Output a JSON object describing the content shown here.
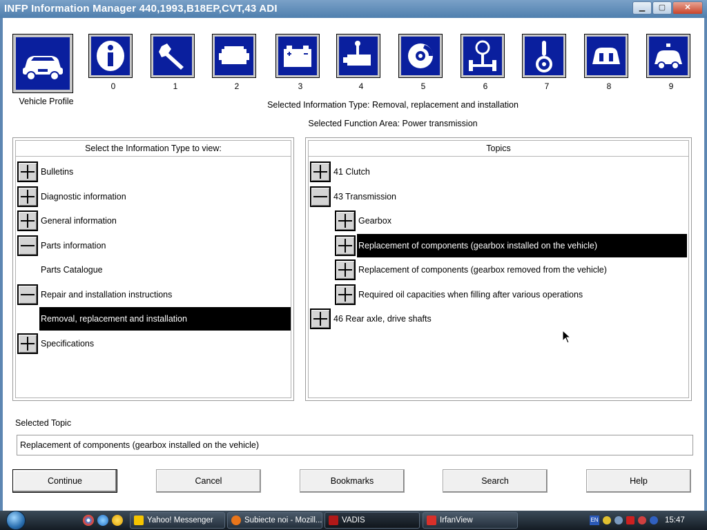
{
  "window": {
    "title": "INFP Information Manager 440,1993,B18EP,CVT,43 ADI",
    "minimize_glyph": "▁",
    "maximize_glyph": "▢",
    "close_glyph": "✕"
  },
  "icons": [
    {
      "id": "vehicle-profile",
      "icon": "car-icon",
      "label": "Vehicle Profile"
    },
    {
      "id": "info",
      "icon": "info-icon",
      "label": "0"
    },
    {
      "id": "tools",
      "icon": "wrench-icon",
      "label": "1"
    },
    {
      "id": "engine",
      "icon": "engine-icon",
      "label": "2"
    },
    {
      "id": "electrical",
      "icon": "battery-icon",
      "label": "3"
    },
    {
      "id": "transmission",
      "icon": "gearbox-icon",
      "label": "4"
    },
    {
      "id": "brakes",
      "icon": "brake-disc-icon",
      "label": "5"
    },
    {
      "id": "steering",
      "icon": "steering-suspension-icon",
      "label": "6"
    },
    {
      "id": "climate",
      "icon": "thermometer-fan-icon",
      "label": "7"
    },
    {
      "id": "body",
      "icon": "car-interior-icon",
      "label": "8"
    },
    {
      "id": "special",
      "icon": "police-car-icon",
      "label": "9"
    }
  ],
  "selection": {
    "info_type": "Selected Information Type: Removal, replacement and installation",
    "function_area": "Selected Function Area: Power transmission"
  },
  "info_panel": {
    "header": "Select the Information Type to view:",
    "items": [
      {
        "label": "Bulletins",
        "expander": "plus",
        "level": 0,
        "selected": false
      },
      {
        "label": "Diagnostic information",
        "expander": "plus",
        "level": 0,
        "selected": false
      },
      {
        "label": "General information",
        "expander": "plus",
        "level": 0,
        "selected": false
      },
      {
        "label": "Parts information",
        "expander": "minus",
        "level": 0,
        "selected": false
      },
      {
        "label": "Parts Catalogue",
        "expander": "none",
        "level": 1,
        "selected": false
      },
      {
        "label": "Repair and installation instructions",
        "expander": "minus",
        "level": 0,
        "selected": false
      },
      {
        "label": "Removal, replacement and installation",
        "expander": "none",
        "level": 1,
        "selected": true
      },
      {
        "label": "Specifications",
        "expander": "plus",
        "level": 0,
        "selected": false
      }
    ]
  },
  "topics_panel": {
    "header": "Topics",
    "items": [
      {
        "label": "41 Clutch",
        "expander": "plus",
        "level": 0,
        "selected": false
      },
      {
        "label": "43 Transmission",
        "expander": "minus",
        "level": 0,
        "selected": false
      },
      {
        "label": "Gearbox",
        "expander": "plus",
        "level": 1,
        "selected": false
      },
      {
        "label": "Replacement of components (gearbox installed on the vehicle)",
        "expander": "plus",
        "level": 1,
        "selected": true
      },
      {
        "label": "Replacement of components (gearbox removed from the vehicle)",
        "expander": "plus",
        "level": 1,
        "selected": false
      },
      {
        "label": "Required oil capacities when filling after various operations",
        "expander": "plus",
        "level": 1,
        "selected": false
      },
      {
        "label": "46 Rear axle, drive shafts",
        "expander": "plus",
        "level": 0,
        "selected": false
      }
    ]
  },
  "selected_topic": {
    "label": "Selected Topic",
    "value": "Replacement of components (gearbox installed on the vehicle)"
  },
  "buttons": {
    "continue": "Continue",
    "cancel": "Cancel",
    "bookmarks": "Bookmarks",
    "search": "Search",
    "help": "Help"
  },
  "taskbar": {
    "tasks": [
      {
        "label": "Yahoo! Messenger",
        "icon": "yahoo-messenger-icon",
        "color": "#f5c400"
      },
      {
        "label": "Subiecte noi - Mozill...",
        "icon": "firefox-icon",
        "color": "#e8751a"
      },
      {
        "label": "VADIS",
        "icon": "vadis-icon",
        "color": "#b01818"
      },
      {
        "label": "IrfanView",
        "icon": "irfanview-icon",
        "color": "#d9302a"
      }
    ],
    "language": "EN",
    "clock": "15:47"
  },
  "colors": {
    "icon_bg": "#0a1f9e",
    "selection_bg": "#000000",
    "title_bar": "#4f7fae"
  }
}
